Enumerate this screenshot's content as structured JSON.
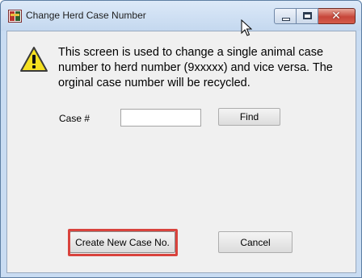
{
  "window": {
    "title": "Change Herd Case Number",
    "app_icon": "herd-app-icon",
    "controls": {
      "minimize": "minimize-icon",
      "maximize": "maximize-icon",
      "close": "close-icon",
      "close_glyph": "✕"
    }
  },
  "warning": {
    "icon": "warning-icon",
    "message": "This screen is used to change a single animal case number to herd number (9xxxxx) and vice versa.  The orginal case number will be recycled."
  },
  "case": {
    "label": "Case #",
    "value": "",
    "find_label": "Find"
  },
  "actions": {
    "create_label": "Create New Case No.",
    "cancel_label": "Cancel"
  },
  "colors": {
    "highlight": "#d9433d",
    "warning_fill": "#f5e020",
    "titlebar": "#c9dcf2"
  }
}
